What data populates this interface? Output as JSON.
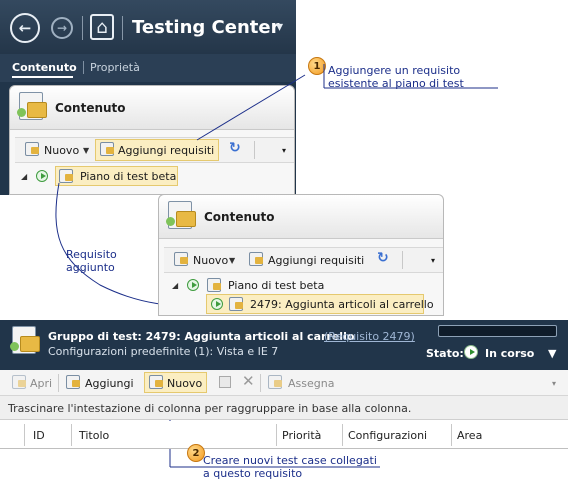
{
  "testing_center": {
    "title": "Testing Center",
    "tabs": [
      "Contenuto",
      "Proprietà"
    ],
    "back_glyph": "←",
    "forward_glyph": "→",
    "home_glyph": "⌂",
    "dropdown_glyph": "▾"
  },
  "panel1": {
    "title": "Contenuto",
    "toolbar": {
      "new_label": "Nuovo",
      "add_req_label": "Aggiungi requisiti"
    },
    "tree": [
      "Piano di test beta"
    ]
  },
  "panel2": {
    "title": "Contenuto",
    "toolbar": {
      "new_label": "Nuovo",
      "add_req_label": "Aggiungi requisiti"
    },
    "tree": [
      "Piano di test beta",
      "2479: Aggiunta articoli al carrello"
    ]
  },
  "callouts": {
    "one": {
      "number": "1",
      "text_line1": "Aggiungere un requisito",
      "text_line2": "esistente al piano di test"
    },
    "added": {
      "line1": "Requisito",
      "line2": "aggiunto"
    },
    "two": {
      "number": "2",
      "text_line1": "Creare nuovi test case collegati",
      "text_line2": "a questo requisito"
    }
  },
  "suite": {
    "title": "Gruppo di test: 2479: Aggiunta articoli al carrello",
    "link": "(Requisito 2479)",
    "configs": "Configurazioni predefinite (1): Vista e IE 7",
    "status_label": "Stato:",
    "status_value": "In corso"
  },
  "grid": {
    "toolbar": {
      "open": "Apri",
      "add": "Aggiungi",
      "new": "Nuovo",
      "assign": "Assegna"
    },
    "group_hint": "Trascinare l'intestazione di colonna per raggruppare in base alla colonna.",
    "columns": [
      "ID",
      "Titolo",
      "Priorità",
      "Configurazioni",
      "Area"
    ]
  },
  "colors": {
    "header_bg": "#21354a",
    "callout_text": "#1c2f8a",
    "highlight": "#fbeec2",
    "badge": "#f39a1e"
  }
}
